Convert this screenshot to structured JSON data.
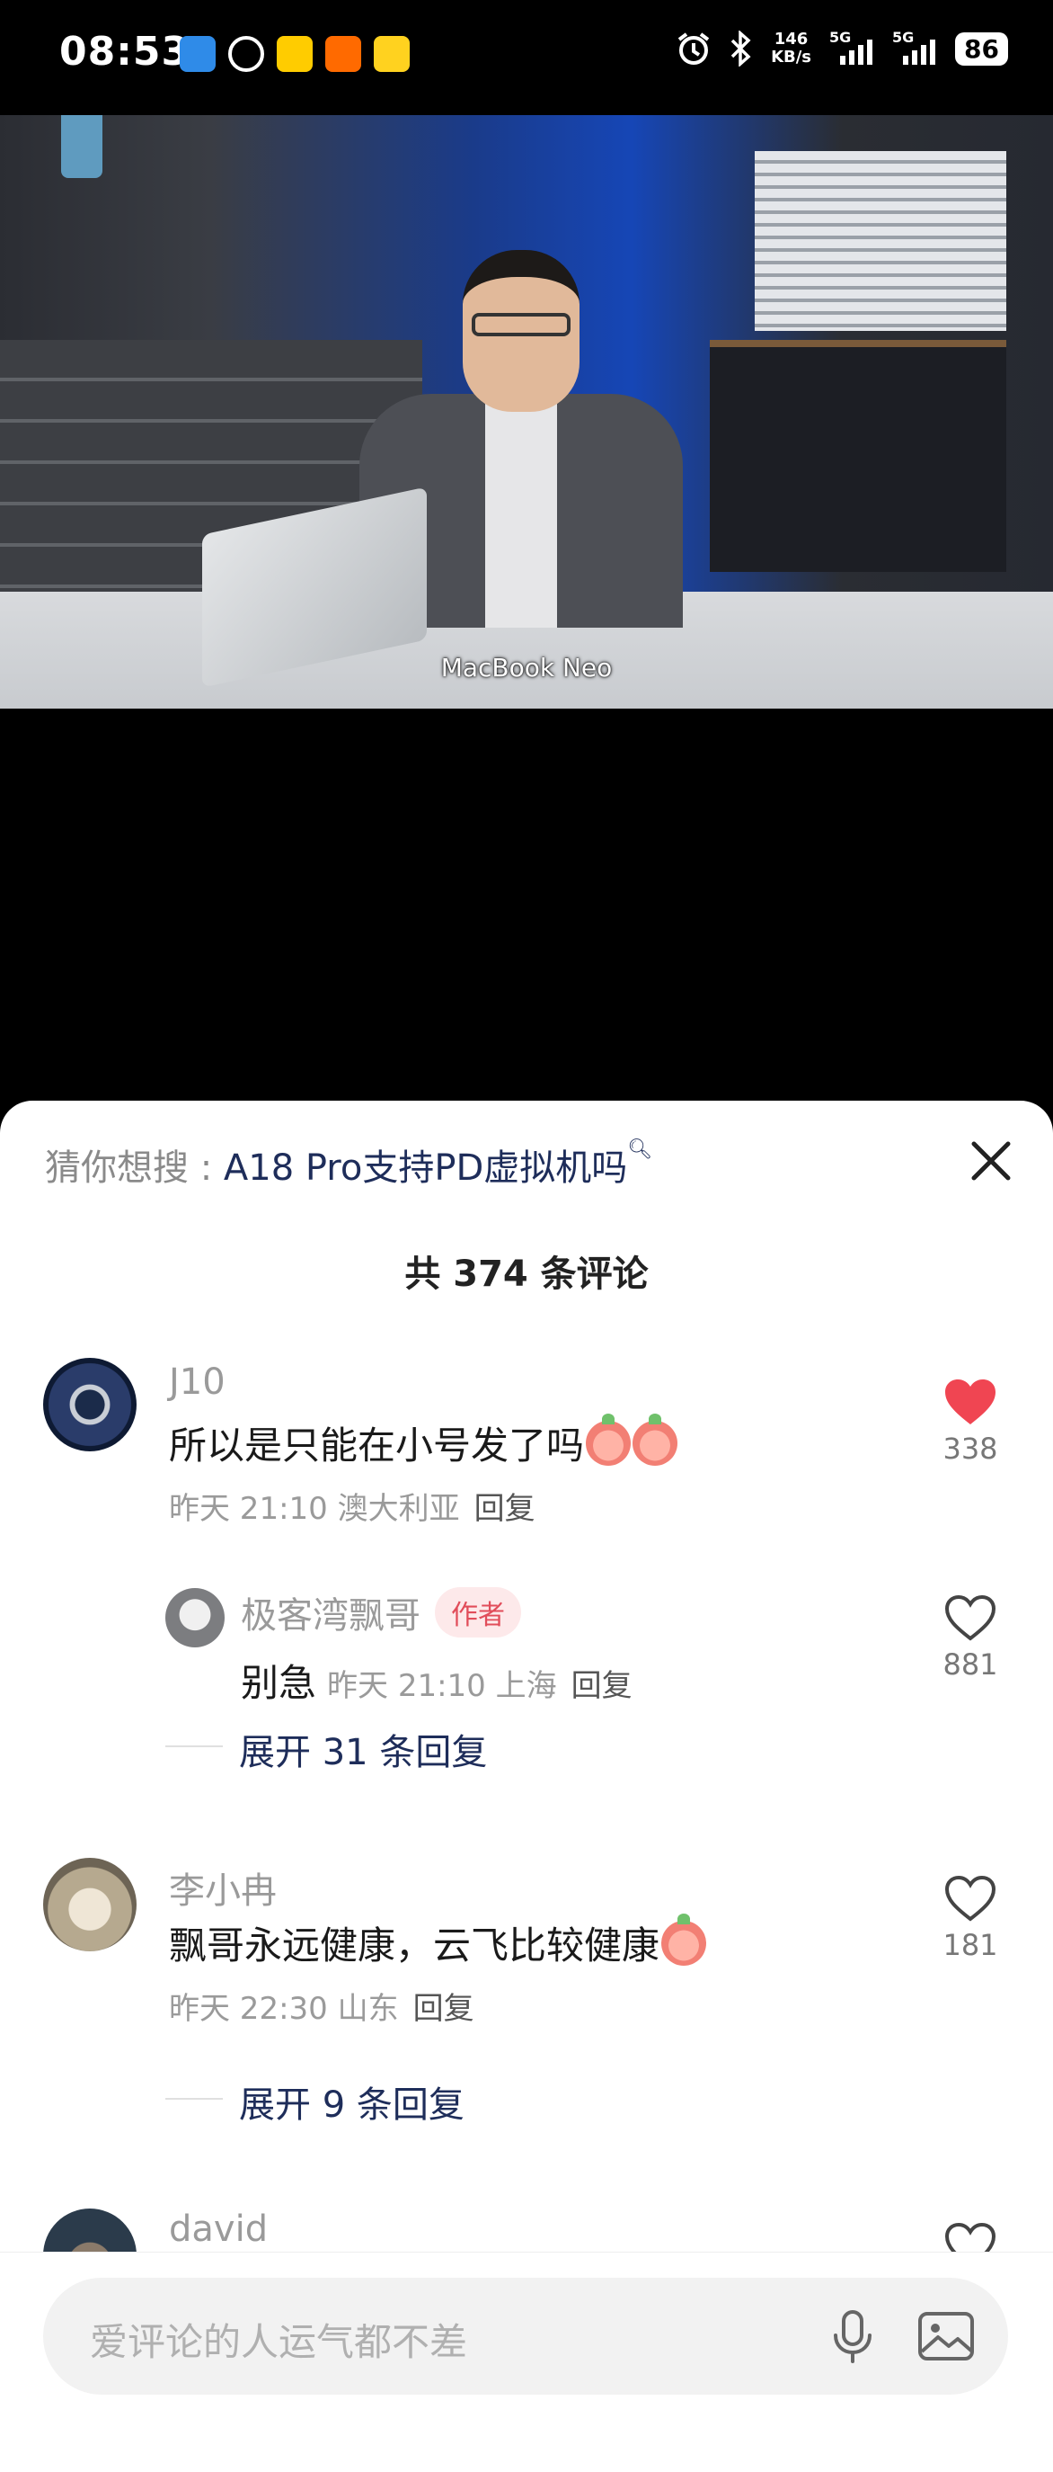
{
  "status_bar": {
    "time": "08:53",
    "net_speed_value": "146",
    "net_speed_unit": "KB/s",
    "signal1": "5G",
    "signal2": "5G",
    "battery": "86"
  },
  "video": {
    "caption": "MacBook Neo"
  },
  "comments_sheet": {
    "guess_prefix": "猜你想搜 : ",
    "guess_query": "A18 Pro支持PD虚拟机吗",
    "count_label": "共 374 条评论",
    "comments": [
      {
        "username": "J10",
        "text": "所以是只能在小号发了吗",
        "time": "昨天 21:10 澳大利亚",
        "reply_label": "回复",
        "likes": "338",
        "liked": true
      },
      {
        "username": "李小冉",
        "text": "飘哥永远健康，云飞比较健康",
        "time": "昨天 22:30 山东",
        "reply_label": "回复",
        "likes": "181",
        "liked": false
      },
      {
        "username": "david"
      }
    ],
    "sub_reply": {
      "username": "极客湾飘哥",
      "tag": "作者",
      "text": "别急",
      "time": "昨天 21:10 上海",
      "reply_label": "回复",
      "likes": "881"
    },
    "expand_1": "展开 31 条回复",
    "expand_2": "展开 9 条回复"
  },
  "input_bar": {
    "placeholder": "爱评论的人运气都不差"
  },
  "colors": {
    "like_active": "#f04552",
    "link": "#1e2d5a",
    "author_tag_bg": "#fde9ea",
    "author_tag_text": "#e14d5a"
  }
}
